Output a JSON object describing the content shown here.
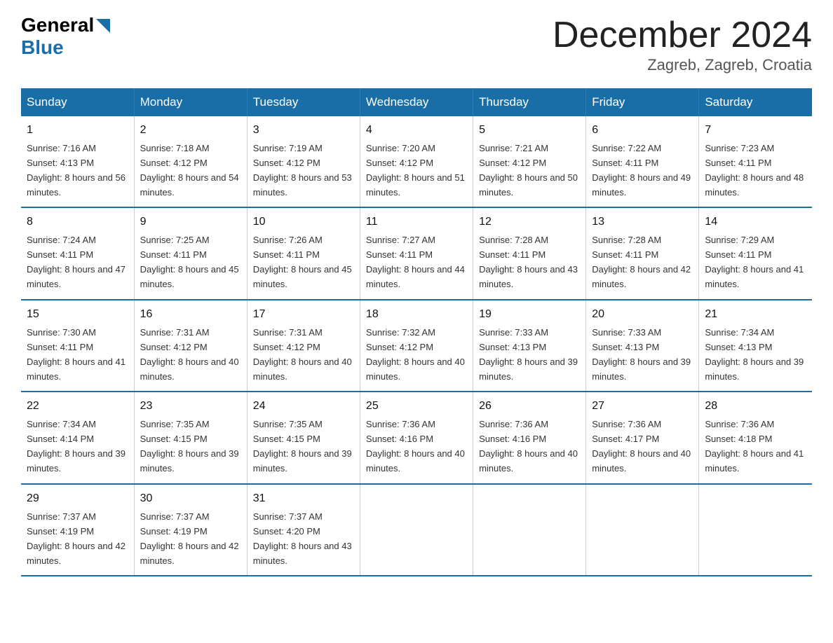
{
  "logo": {
    "general": "General",
    "blue": "Blue"
  },
  "title": "December 2024",
  "location": "Zagreb, Zagreb, Croatia",
  "days_header": [
    "Sunday",
    "Monday",
    "Tuesday",
    "Wednesday",
    "Thursday",
    "Friday",
    "Saturday"
  ],
  "weeks": [
    [
      {
        "num": "1",
        "sunrise": "7:16 AM",
        "sunset": "4:13 PM",
        "daylight": "8 hours and 56 minutes."
      },
      {
        "num": "2",
        "sunrise": "7:18 AM",
        "sunset": "4:12 PM",
        "daylight": "8 hours and 54 minutes."
      },
      {
        "num": "3",
        "sunrise": "7:19 AM",
        "sunset": "4:12 PM",
        "daylight": "8 hours and 53 minutes."
      },
      {
        "num": "4",
        "sunrise": "7:20 AM",
        "sunset": "4:12 PM",
        "daylight": "8 hours and 51 minutes."
      },
      {
        "num": "5",
        "sunrise": "7:21 AM",
        "sunset": "4:12 PM",
        "daylight": "8 hours and 50 minutes."
      },
      {
        "num": "6",
        "sunrise": "7:22 AM",
        "sunset": "4:11 PM",
        "daylight": "8 hours and 49 minutes."
      },
      {
        "num": "7",
        "sunrise": "7:23 AM",
        "sunset": "4:11 PM",
        "daylight": "8 hours and 48 minutes."
      }
    ],
    [
      {
        "num": "8",
        "sunrise": "7:24 AM",
        "sunset": "4:11 PM",
        "daylight": "8 hours and 47 minutes."
      },
      {
        "num": "9",
        "sunrise": "7:25 AM",
        "sunset": "4:11 PM",
        "daylight": "8 hours and 45 minutes."
      },
      {
        "num": "10",
        "sunrise": "7:26 AM",
        "sunset": "4:11 PM",
        "daylight": "8 hours and 45 minutes."
      },
      {
        "num": "11",
        "sunrise": "7:27 AM",
        "sunset": "4:11 PM",
        "daylight": "8 hours and 44 minutes."
      },
      {
        "num": "12",
        "sunrise": "7:28 AM",
        "sunset": "4:11 PM",
        "daylight": "8 hours and 43 minutes."
      },
      {
        "num": "13",
        "sunrise": "7:28 AM",
        "sunset": "4:11 PM",
        "daylight": "8 hours and 42 minutes."
      },
      {
        "num": "14",
        "sunrise": "7:29 AM",
        "sunset": "4:11 PM",
        "daylight": "8 hours and 41 minutes."
      }
    ],
    [
      {
        "num": "15",
        "sunrise": "7:30 AM",
        "sunset": "4:11 PM",
        "daylight": "8 hours and 41 minutes."
      },
      {
        "num": "16",
        "sunrise": "7:31 AM",
        "sunset": "4:12 PM",
        "daylight": "8 hours and 40 minutes."
      },
      {
        "num": "17",
        "sunrise": "7:31 AM",
        "sunset": "4:12 PM",
        "daylight": "8 hours and 40 minutes."
      },
      {
        "num": "18",
        "sunrise": "7:32 AM",
        "sunset": "4:12 PM",
        "daylight": "8 hours and 40 minutes."
      },
      {
        "num": "19",
        "sunrise": "7:33 AM",
        "sunset": "4:13 PM",
        "daylight": "8 hours and 39 minutes."
      },
      {
        "num": "20",
        "sunrise": "7:33 AM",
        "sunset": "4:13 PM",
        "daylight": "8 hours and 39 minutes."
      },
      {
        "num": "21",
        "sunrise": "7:34 AM",
        "sunset": "4:13 PM",
        "daylight": "8 hours and 39 minutes."
      }
    ],
    [
      {
        "num": "22",
        "sunrise": "7:34 AM",
        "sunset": "4:14 PM",
        "daylight": "8 hours and 39 minutes."
      },
      {
        "num": "23",
        "sunrise": "7:35 AM",
        "sunset": "4:15 PM",
        "daylight": "8 hours and 39 minutes."
      },
      {
        "num": "24",
        "sunrise": "7:35 AM",
        "sunset": "4:15 PM",
        "daylight": "8 hours and 39 minutes."
      },
      {
        "num": "25",
        "sunrise": "7:36 AM",
        "sunset": "4:16 PM",
        "daylight": "8 hours and 40 minutes."
      },
      {
        "num": "26",
        "sunrise": "7:36 AM",
        "sunset": "4:16 PM",
        "daylight": "8 hours and 40 minutes."
      },
      {
        "num": "27",
        "sunrise": "7:36 AM",
        "sunset": "4:17 PM",
        "daylight": "8 hours and 40 minutes."
      },
      {
        "num": "28",
        "sunrise": "7:36 AM",
        "sunset": "4:18 PM",
        "daylight": "8 hours and 41 minutes."
      }
    ],
    [
      {
        "num": "29",
        "sunrise": "7:37 AM",
        "sunset": "4:19 PM",
        "daylight": "8 hours and 42 minutes."
      },
      {
        "num": "30",
        "sunrise": "7:37 AM",
        "sunset": "4:19 PM",
        "daylight": "8 hours and 42 minutes."
      },
      {
        "num": "31",
        "sunrise": "7:37 AM",
        "sunset": "4:20 PM",
        "daylight": "8 hours and 43 minutes."
      },
      null,
      null,
      null,
      null
    ]
  ]
}
